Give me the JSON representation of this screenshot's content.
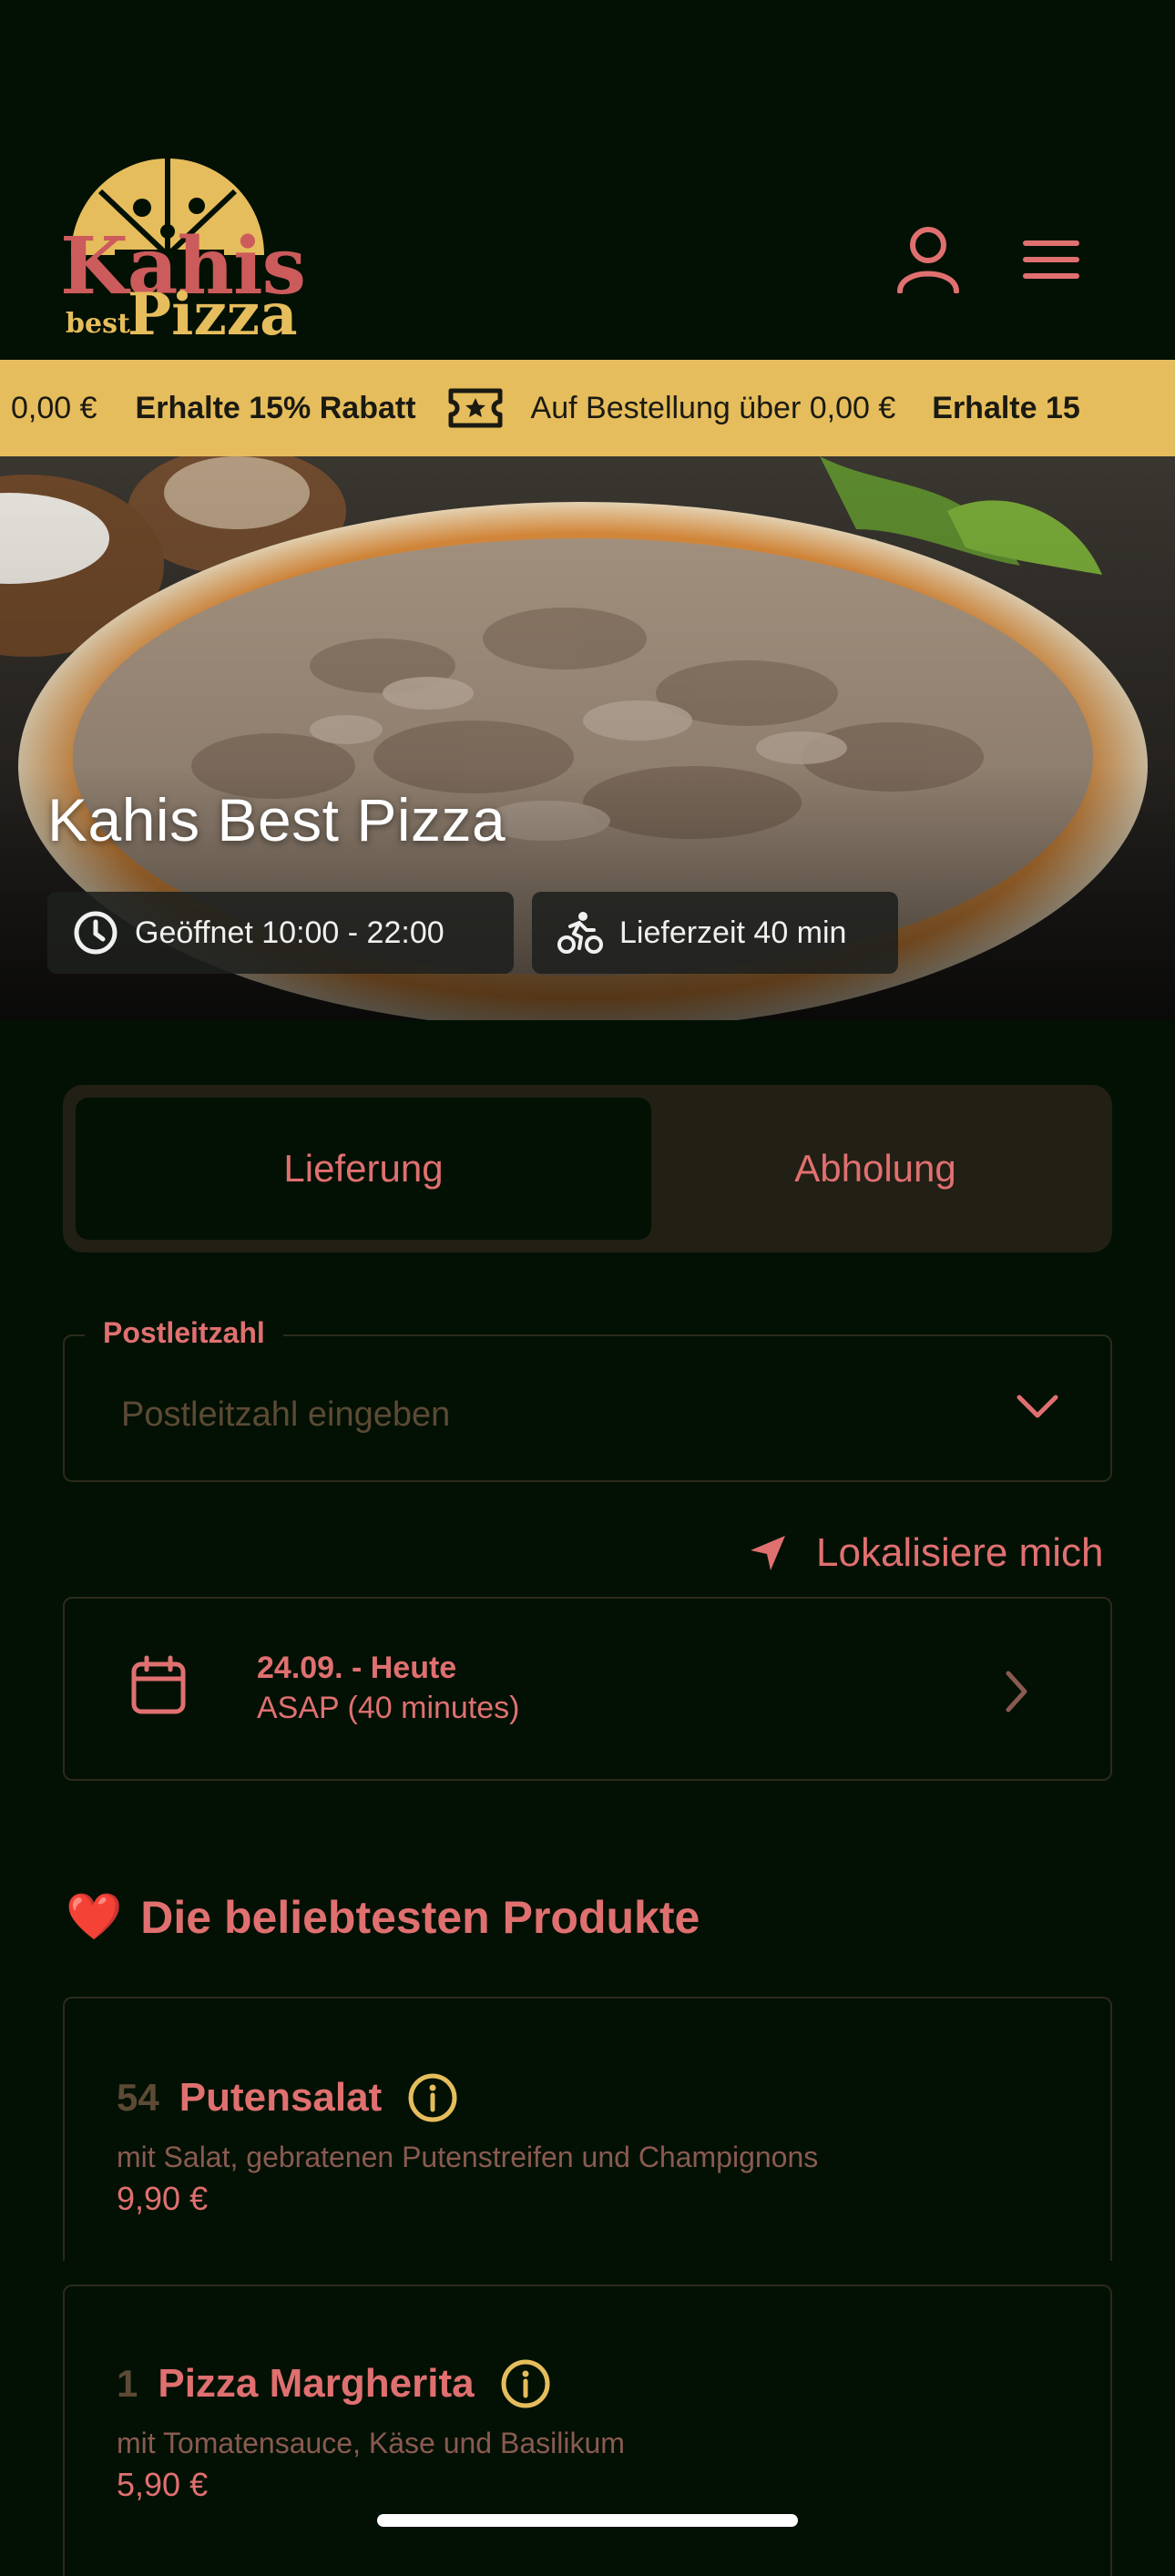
{
  "brand": {
    "logo_line1": "Kahis",
    "logo_small": "best",
    "logo_line2": "Pizza"
  },
  "header": {
    "account_icon": "user-icon",
    "menu_icon": "hamburger-menu-icon"
  },
  "promo_banner": {
    "lead_fragment": "0,00 €",
    "items": [
      {
        "bold": "Erhalte 15% Rabatt",
        "text": "Auf Bestellung über 0,00 €",
        "icon": "ticket-icon"
      },
      {
        "bold": "Erhalte 15",
        "text": "",
        "icon": ""
      }
    ]
  },
  "hero": {
    "title": "Kahis Best Pizza",
    "opening_hours": "Geöffnet 10:00 - 22:00",
    "delivery_time": "Lieferzeit 40 min"
  },
  "order_mode": {
    "options": [
      "Lieferung",
      "Abholung"
    ],
    "selected": "Lieferung"
  },
  "postcode": {
    "label": "Postleitzahl",
    "placeholder": "Postleitzahl eingeben",
    "value": ""
  },
  "locate": {
    "label": "Lokalisiere mich"
  },
  "schedule": {
    "date": "24.09. - Heute",
    "time": "ASAP (40 minutes)"
  },
  "popular": {
    "emoji": "❤️",
    "title": "Die beliebtesten Produkte",
    "products": [
      {
        "number": "54",
        "name": "Putensalat",
        "description": "mit Salat, gebratenen Putenstreifen und Champignons",
        "price": "9,90 €"
      },
      {
        "number": "1",
        "name": "Pizza Margherita",
        "description": "mit Tomatensauce, Käse und Basilikum",
        "price": "5,90 €"
      }
    ]
  },
  "colors": {
    "background": "#021104",
    "accent": "#e07070",
    "banner": "#e6bd5c",
    "info_icon": "#e6bd5c"
  }
}
